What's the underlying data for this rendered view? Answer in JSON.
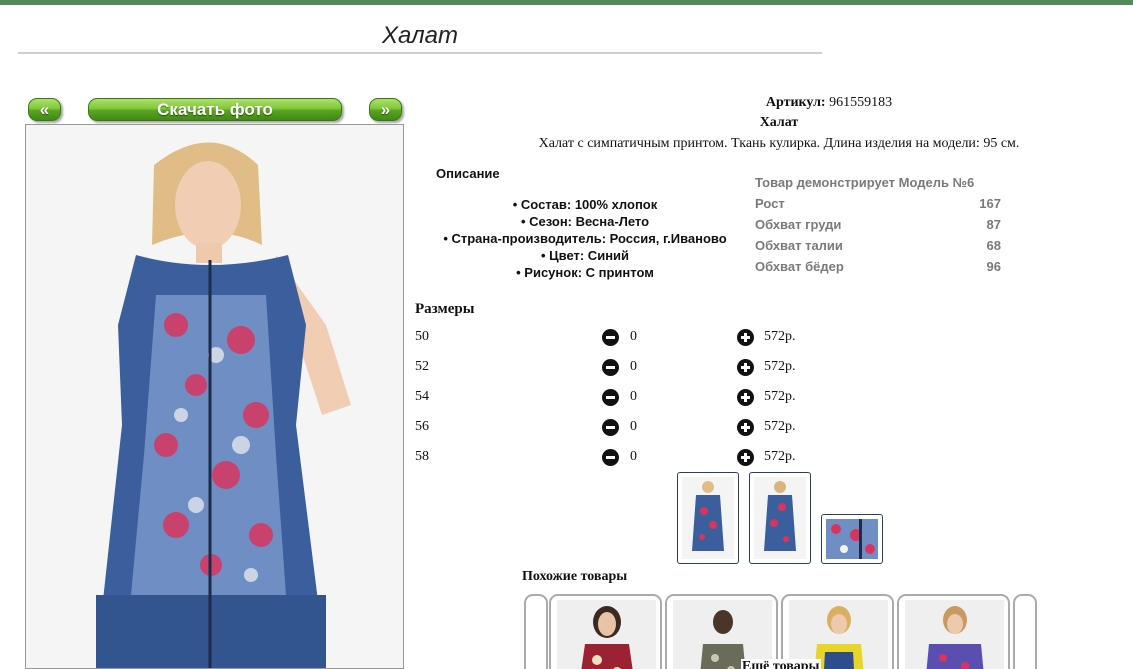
{
  "page": {
    "title": "Халат"
  },
  "gallery": {
    "prev_label": "«",
    "download_label": "Скачать фото",
    "next_label": "»"
  },
  "product": {
    "article_label": "Артикул:",
    "article_value": "961559183",
    "name": "Халат",
    "short_description": "Халат с симпатичным принтом. Ткань кулирка. Длина изделия на модели: 95 см."
  },
  "description": {
    "heading": "Описание",
    "items": [
      "Состав: 100% хлопок",
      "Сезон: Весна-Лето",
      "Страна-производитель: Россия, г.Иваново",
      "Цвет: Синий",
      "Рисунок: С принтом"
    ]
  },
  "model": {
    "heading": "Товар демонстрирует Модель №6",
    "rows": [
      {
        "label": "Рост",
        "value": "167"
      },
      {
        "label": "Обхват груди",
        "value": "87"
      },
      {
        "label": "Обхват талии",
        "value": "68"
      },
      {
        "label": "Обхват бёдер",
        "value": "96"
      }
    ]
  },
  "sizes": {
    "heading": "Размеры",
    "rows": [
      {
        "size": "50",
        "qty": "0",
        "price": "572р."
      },
      {
        "size": "52",
        "qty": "0",
        "price": "572р."
      },
      {
        "size": "54",
        "qty": "0",
        "price": "572р."
      },
      {
        "size": "56",
        "qty": "0",
        "price": "572р."
      },
      {
        "size": "58",
        "qty": "0",
        "price": "572р."
      }
    ]
  },
  "similar": {
    "heading": "Похожие товары",
    "more_label": "Ещё товары"
  },
  "colors": {
    "button_green": "#5aa322",
    "dress_blue": "#3a5f9c",
    "flower_pink": "#d9345e",
    "thumb_border": "#2c3e6a"
  },
  "icons": {
    "minus": "minus-circle-icon",
    "plus": "plus-circle-icon"
  }
}
